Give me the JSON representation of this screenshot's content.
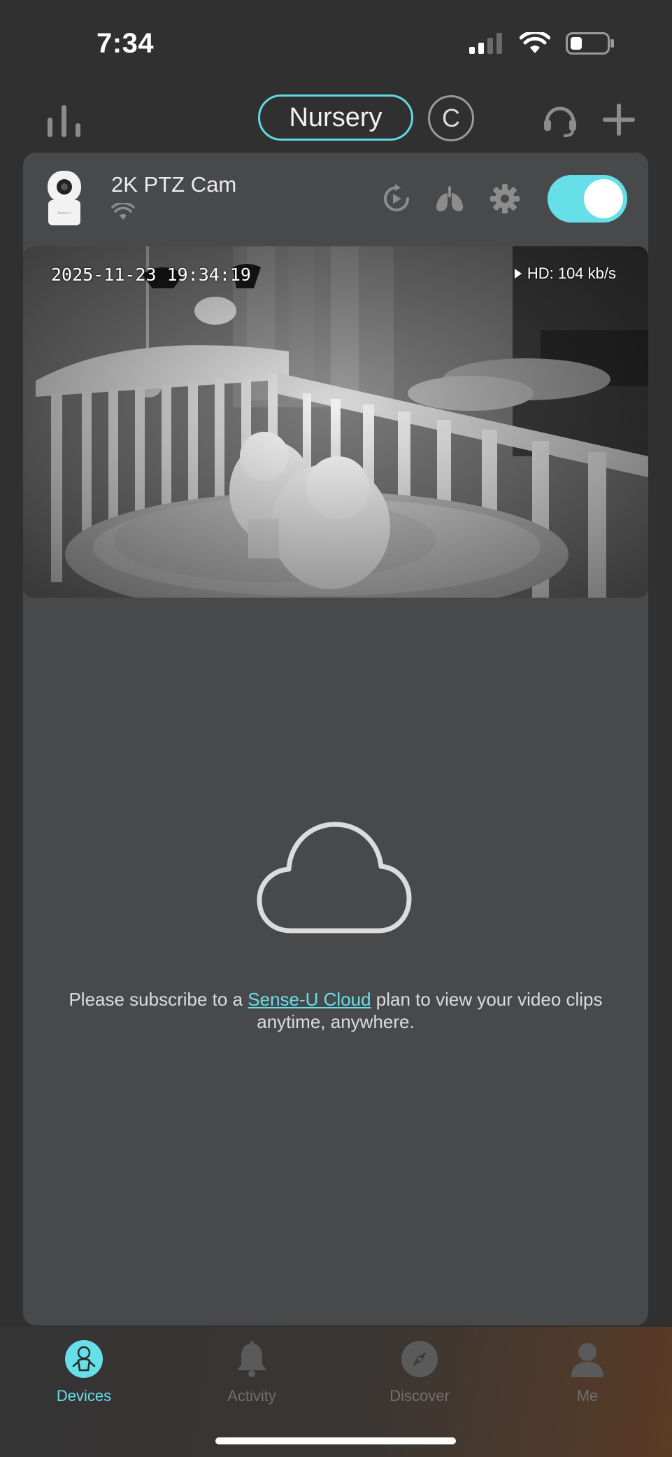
{
  "status_bar": {
    "time": "7:34",
    "signal_bars_active": 2,
    "battery_level": 0.3
  },
  "header": {
    "home_name": "Nursery",
    "home_switch_letter": "C"
  },
  "device": {
    "name": "2K PTZ Cam",
    "thumb_brand": "Sense-U",
    "enabled": true,
    "camera": {
      "timestamp": "2025-11-23 19:34:19",
      "stream_info": "HD: 104 kb/s"
    }
  },
  "cloud_prompt": {
    "before_link": "Please subscribe to a ",
    "link": "Sense-U Cloud",
    "after_link": " plan to view your video clips anytime, anywhere."
  },
  "nav": {
    "items": [
      {
        "label": "Devices",
        "icon": "baby-icon",
        "active": true
      },
      {
        "label": "Activity",
        "icon": "bell-icon",
        "active": false
      },
      {
        "label": "Discover",
        "icon": "compass-icon",
        "active": false
      },
      {
        "label": "Me",
        "icon": "person-icon",
        "active": false
      }
    ]
  },
  "colors": {
    "accent": "#66dfe8",
    "background": "#303030",
    "card": "#48494b",
    "inactive": "#707070"
  }
}
